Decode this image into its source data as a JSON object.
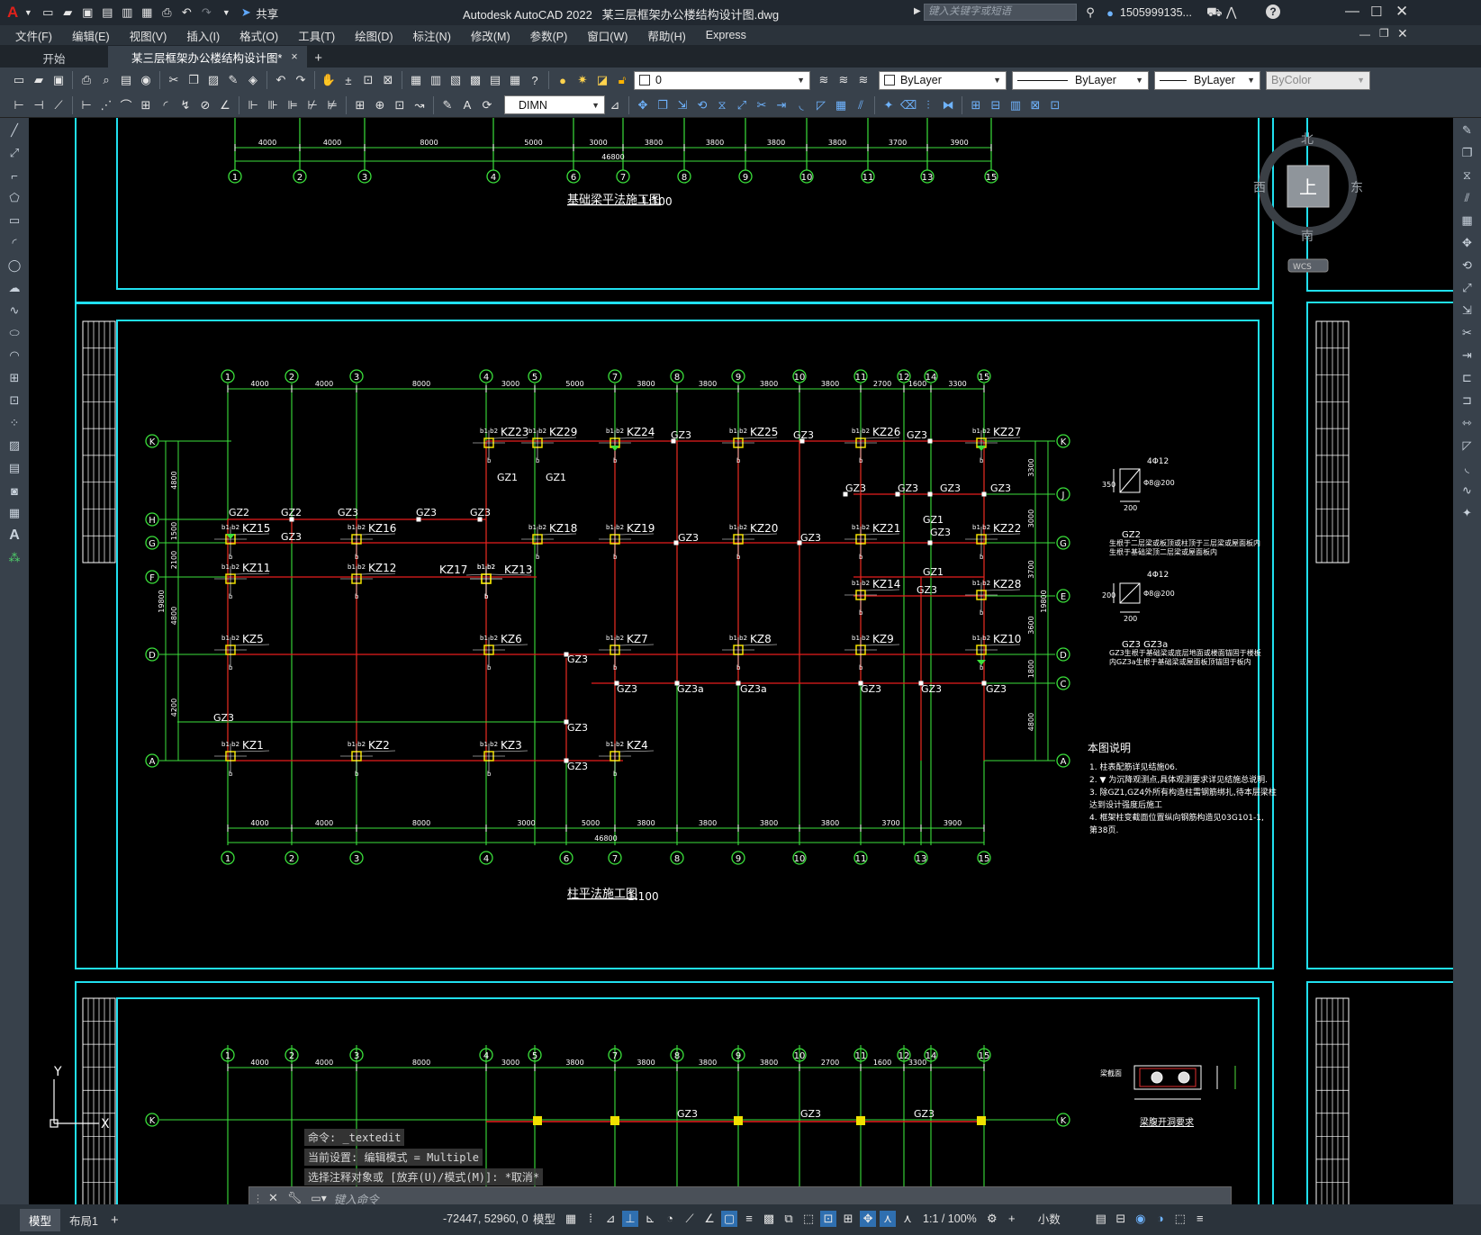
{
  "titlebar": {
    "app_logo": "A",
    "share": "共享",
    "app_name": "Autodesk AutoCAD 2022",
    "file_name": "某三层框架办公楼结构设计图.dwg",
    "search_placeholder": "键入关键字或短语",
    "user": "1505999135...",
    "icons": [
      "new-icon",
      "open-icon",
      "save-icon",
      "saveas-icon",
      "web-icon",
      "plot-icon",
      "undo-icon",
      "redo-icon",
      "share-icon"
    ]
  },
  "menu": [
    "文件(F)",
    "编辑(E)",
    "视图(V)",
    "插入(I)",
    "格式(O)",
    "工具(T)",
    "绘图(D)",
    "标注(N)",
    "修改(M)",
    "参数(P)",
    "窗口(W)",
    "帮助(H)",
    "Express"
  ],
  "tabs": {
    "start": "开始",
    "active": "某三层框架办公楼结构设计图*",
    "close": "×",
    "add": "+"
  },
  "toolbar1": {
    "layer": "0",
    "color": "ByLayer",
    "linetype": "ByLayer",
    "lineweight": "ByLayer",
    "plotstyle": "ByColor"
  },
  "toolbar2": {
    "dimstyle": "DIMN"
  },
  "viewcube": {
    "north": "北",
    "south": "南",
    "east": "东",
    "west": "西",
    "face": "上",
    "wcs": "WCS"
  },
  "drawing": {
    "top_axes": [
      "1",
      "2",
      "3",
      "4",
      "6",
      "7",
      "8",
      "9",
      "10",
      "11",
      "13",
      "15"
    ],
    "top_dims": [
      "4000",
      "4000",
      "8000",
      "5000",
      "3000",
      "3800",
      "3800",
      "3800",
      "3800",
      "3700",
      "3900"
    ],
    "top_total": "46800",
    "top_title": "基础梁平法施工图",
    "top_scale": "1:100",
    "mid_axes_top": [
      "1",
      "2",
      "3",
      "4",
      "5",
      "7",
      "8",
      "9",
      "10",
      "11",
      "12",
      "14",
      "15"
    ],
    "mid_dims_top": [
      "4000",
      "4000",
      "8000",
      "3000",
      "5000",
      "3800",
      "3800",
      "3800",
      "3800",
      "2700",
      "1600",
      "3300"
    ],
    "mid_axes_bottom": [
      "1",
      "2",
      "3",
      "4",
      "6",
      "7",
      "8",
      "9",
      "10",
      "11",
      "13",
      "15"
    ],
    "mid_dims_bottom": [
      "4000",
      "4000",
      "8000",
      "3000",
      "5000",
      "3800",
      "3800",
      "3800",
      "3800",
      "3700",
      "3900"
    ],
    "mid_total": "46800",
    "rows_left": [
      "K",
      "H",
      "G",
      "F",
      "D",
      "A"
    ],
    "rows_right": [
      "K",
      "J",
      "G",
      "E",
      "D",
      "C",
      "A"
    ],
    "left_dims": [
      "4800",
      "1500",
      "2100",
      "4800",
      "4200",
      "2400"
    ],
    "left_total": "19800",
    "right_dims": [
      "3300",
      "3000",
      "3700",
      "3600",
      "1800",
      "4800"
    ],
    "right_total": "19800",
    "columns": [
      "KZ23",
      "KZ29",
      "KZ24",
      "KZ25",
      "KZ26",
      "KZ27",
      "KZ15",
      "KZ16",
      "KZ18",
      "KZ19",
      "KZ20",
      "KZ21",
      "KZ22",
      "KZ11",
      "KZ12",
      "KZ17",
      "KZ13",
      "KZ14",
      "KZ28",
      "KZ5",
      "KZ6",
      "KZ7",
      "KZ8",
      "KZ9",
      "KZ10",
      "KZ1",
      "KZ2",
      "KZ3",
      "KZ4"
    ],
    "gz_labels": [
      "GZ1",
      "GZ2",
      "GZ3",
      "GZ3a"
    ],
    "mid_title": "柱平法施工图",
    "mid_scale": "1:100",
    "detail1": {
      "top": "4Φ12",
      "right": "Φ8@200",
      "left": "350",
      "bottom": "200"
    },
    "detail2_title": "GZ2",
    "detail2_text": "生根于二层梁或板顶或柱顶于三层梁或屋面板内生根于基础梁顶二层梁或屋面板内",
    "detail3": {
      "top": "4Φ12",
      "right": "Φ8@200",
      "left": "200",
      "bottom": "200"
    },
    "detail3_title": "GZ3  GZ3a",
    "detail3_text": "GZ3生根于基础梁或底层地面或楼面锚固于楼板内GZ3a生根于基础梁或屋面板顶锚固于板内",
    "notes_title": "本图说明",
    "notes": [
      "1. 柱表配筋详见结施06.",
      "2. ▼ 为沉降观测点,具体观测要求详见结施总说明.",
      "3. 除GZ1,GZ4外所有构造柱需钢筋绑扎,待本层梁柱",
      "   达到设计强度后施工",
      "4. 框架柱变截面位置纵向钢筋构造见03G101-1,",
      "   第38页."
    ],
    "bottom_axes": [
      "1",
      "2",
      "3",
      "4",
      "5",
      "7",
      "8",
      "9",
      "10",
      "11",
      "12",
      "14",
      "15"
    ],
    "bottom_dims": [
      "4000",
      "4000",
      "8000",
      "3000",
      "3800",
      "3800",
      "3800",
      "3800",
      "2700",
      "1600",
      "3300"
    ],
    "bottom_detail_title": "梁腹开洞要求",
    "bottom_detail_label": "梁截面"
  },
  "command": {
    "history": [
      "命令: _textedit",
      "当前设置: 编辑模式 = Multiple",
      "选择注释对象或 [放弃(U)/模式(M)]: *取消*"
    ],
    "placeholder": "键入命令"
  },
  "ucs": {
    "x": "X",
    "y": "Y"
  },
  "statusbar": {
    "model_tab": "模型",
    "layout_tab": "布局1",
    "add": "+",
    "coords": "-72447, 52960, 0",
    "model": "模型",
    "scale": "1:1 / 100%",
    "units": "小数"
  }
}
